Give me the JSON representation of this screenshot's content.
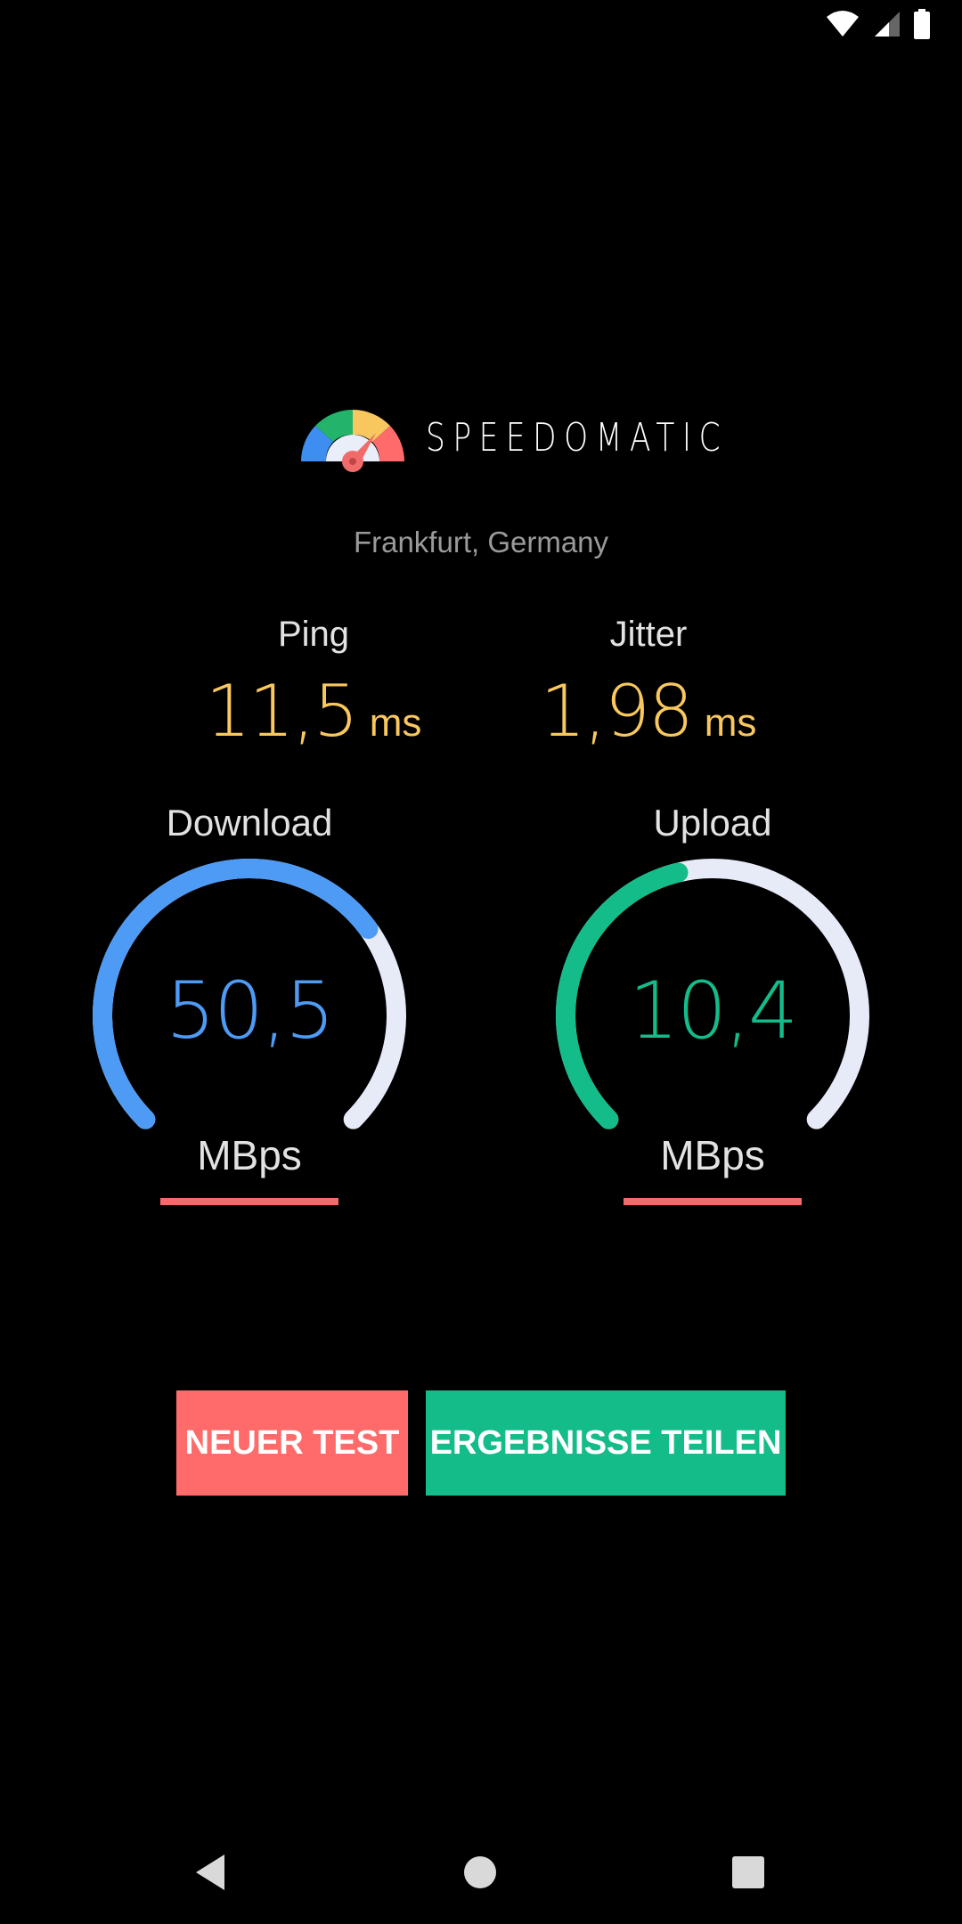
{
  "app": {
    "name": "SPEEDOMATIC",
    "location": "Frankfurt, Germany"
  },
  "metrics": {
    "ping": {
      "label": "Ping",
      "value": "11,5",
      "unit": "ms"
    },
    "jitter": {
      "label": "Jitter",
      "value": "1,98",
      "unit": "ms"
    }
  },
  "gauges": {
    "download": {
      "label": "Download",
      "value": "50,5",
      "unit": "MBps",
      "fill_fraction": 0.7,
      "color": "#4e9bf6"
    },
    "upload": {
      "label": "Upload",
      "value": "10,4",
      "unit": "MBps",
      "fill_fraction": 0.45,
      "color": "#14bc8a"
    }
  },
  "buttons": {
    "new_test": "NEUER TEST",
    "share_results": "ERGEBNISSE TEILEN"
  },
  "colors": {
    "accent_yellow": "#f8c85f",
    "accent_red": "#ff6b6b",
    "track": "#e6ebf7"
  },
  "icons": {
    "status": [
      "wifi-icon",
      "cell-signal-icon",
      "battery-icon"
    ],
    "navigation": [
      "back-icon",
      "home-icon",
      "recents-icon"
    ]
  }
}
